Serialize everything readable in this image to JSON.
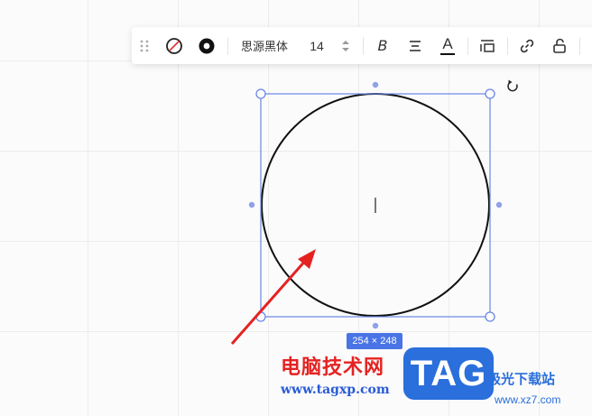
{
  "toolbar": {
    "drag_handle_icon": "drag-handle-icon",
    "fill_icon": "no-fill-icon",
    "stroke_icon": "stroke-style-icon",
    "font_name": "思源黑体",
    "font_size": "14",
    "bold_label": "B",
    "align_label": "Ξ",
    "text_color_label": "A",
    "text_color": "#111111",
    "line_spacing_icon": "line-spacing-icon",
    "link_icon": "link-icon",
    "lock_icon": "unlock-icon"
  },
  "canvas": {
    "shape": "circle",
    "selection_size": "254 × 248",
    "selection_color": "#6b85e6",
    "rotate_icon": "rotate-icon",
    "text_cursor": "|"
  },
  "watermark": {
    "site_name": "电脑技术网",
    "site_url": "www.tagxp.com",
    "tag_label": "TAG",
    "xz_name": "极光下载站",
    "xz_url": "www.xz7.com"
  },
  "colors": {
    "accent": "#4a74e6",
    "arrow": "#e52222"
  }
}
